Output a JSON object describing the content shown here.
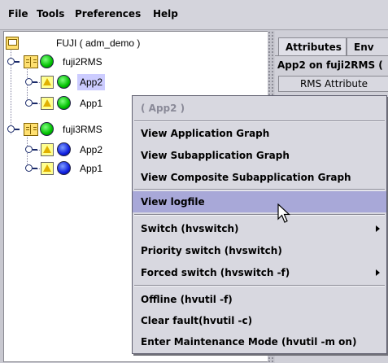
{
  "menubar": {
    "items": [
      "File",
      "Tools",
      "Preferences",
      "Help"
    ]
  },
  "tree": {
    "root": {
      "label": "FUJI ( adm_demo )"
    },
    "nodes": [
      {
        "label": "fuji2RMS",
        "status": "green",
        "apps": [
          {
            "label": "App2",
            "status": "green",
            "selected": true
          },
          {
            "label": "App1",
            "status": "green",
            "selected": false
          }
        ]
      },
      {
        "label": "fuji3RMS",
        "status": "green",
        "apps": [
          {
            "label": "App2",
            "status": "blue",
            "selected": false
          },
          {
            "label": "App1",
            "status": "blue",
            "selected": false
          }
        ]
      }
    ]
  },
  "right_panel": {
    "tabs": [
      "Attributes",
      "Env"
    ],
    "header": "App2 on fuji2RMS (",
    "column_header": "RMS Attribute"
  },
  "context_menu": {
    "title": "( App2 )",
    "group1": [
      "View Application Graph",
      "View Subapplication Graph",
      "View Composite Subapplication Graph"
    ],
    "group2": [
      "View logfile"
    ],
    "group3": [
      "Switch (hvswitch)",
      "Priority switch (hvswitch)",
      "Forced switch (hvswitch -f)"
    ],
    "group4": [
      "Offline (hvutil -f)",
      "Clear fault(hvutil -c)",
      "Enter Maintenance Mode (hvutil -m on)"
    ],
    "highlighted": "View logfile"
  },
  "colors": {
    "online": "#00c000",
    "offline": "#1020e0",
    "highlight": "#a8a8d8",
    "selection": "#ccccff"
  }
}
